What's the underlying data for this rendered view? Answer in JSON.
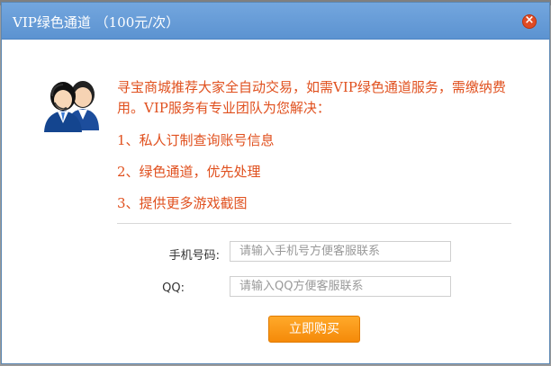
{
  "dialog": {
    "title": "VIP绿色通道 （100元/次）",
    "close_label": "×"
  },
  "content": {
    "intro": "寻宝商城推荐大家全自动交易，如需VIP绿色通道服务，需缴纳费用。VIP服务有专业团队为您解决：",
    "items": [
      "1、私人订制查询账号信息",
      "2、绿色通道，优先处理",
      "3、提供更多游戏截图"
    ]
  },
  "form": {
    "phone_label": "手机号码:",
    "phone_placeholder": "请输入手机号方便客服联系",
    "qq_label": "QQ:",
    "qq_placeholder": "请输入QQ方便客服联系",
    "submit_label": "立即购买"
  },
  "colors": {
    "accent": "#e0501e",
    "title_bar": "#5c93d1",
    "button": "#f58a09"
  },
  "icons": {
    "avatar": "customer-service-icon",
    "close": "close-icon"
  }
}
